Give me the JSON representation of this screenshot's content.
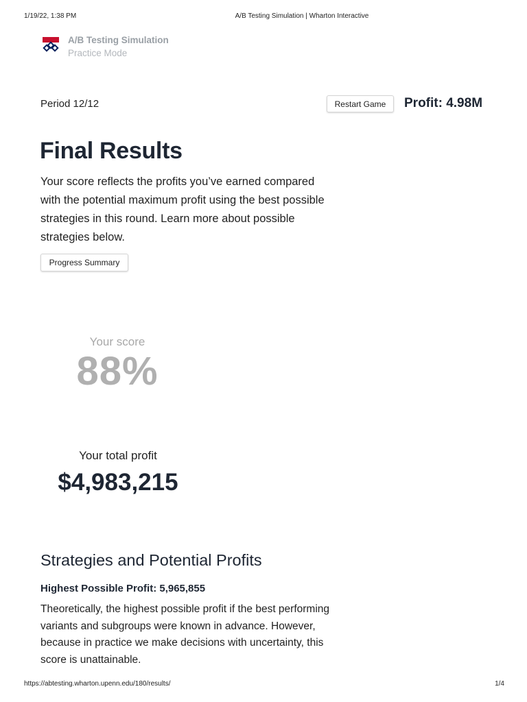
{
  "print_header": {
    "datetime": "1/19/22, 1:38 PM",
    "document_title": "A/B Testing Simulation | Wharton Interactive"
  },
  "app": {
    "name": "A/B Testing Simulation",
    "mode": "Practice Mode",
    "logo_icon": "penn-shield-logo",
    "logo_colors": {
      "top": "#c8102e",
      "bottom": "#011f5b"
    }
  },
  "game_status": {
    "period": "Period 12/12",
    "restart_label": "Restart Game",
    "profit": "Profit: 4.98M"
  },
  "results": {
    "title": "Final Results",
    "description": "Your score reflects the profits you’ve earned compared with the potential maximum profit using the best possible strategies in this round. Learn more about possible strategies below.",
    "progress_summary_label": "Progress Summary",
    "score_label": "Your score",
    "score_value": "88%",
    "total_profit_label": "Your total profit",
    "total_profit_value": "$4,983,215"
  },
  "strategies": {
    "title": "Strategies and Potential Profits",
    "highest_title": "Highest Possible Profit: 5,965,855",
    "highest_description": "Theoretically, the highest possible profit if the best performing variants and subgroups were known in advance. However, because in practice we make decisions with uncertainty, this score is unattainable."
  },
  "print_footer": {
    "url": "https://abtesting.wharton.upenn.edu/180/results/",
    "page": "1/4"
  }
}
